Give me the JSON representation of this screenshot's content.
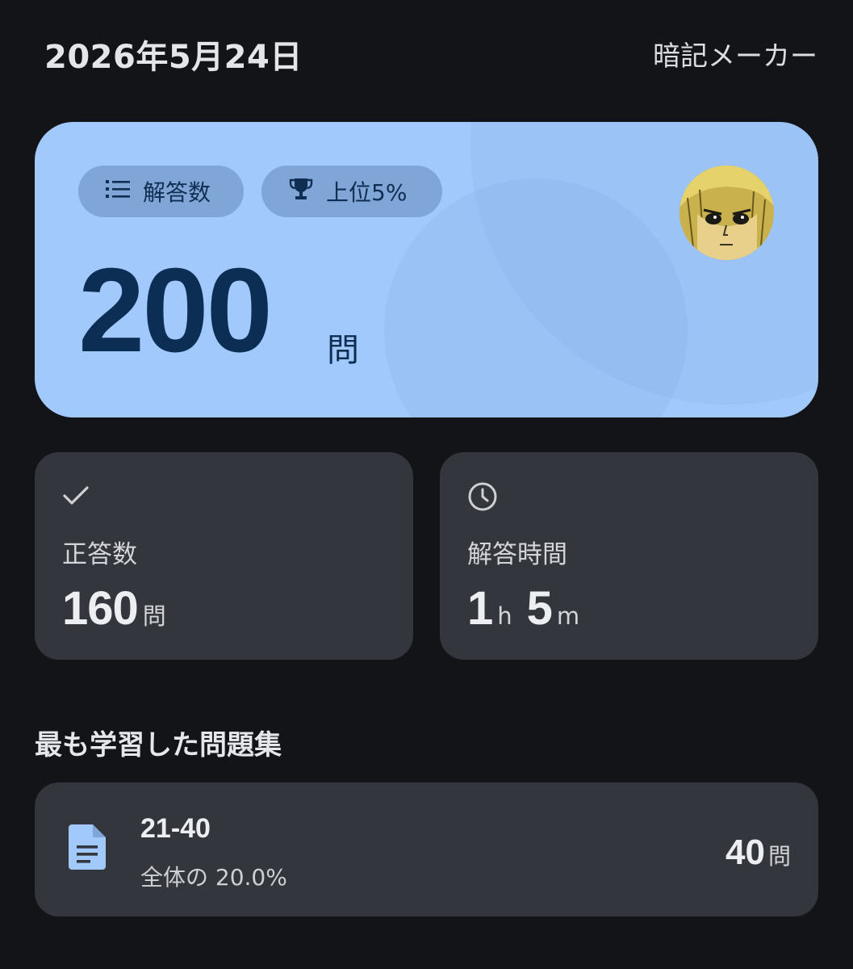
{
  "header": {
    "date": "2026年5月24日",
    "app_name": "暗記メーカー"
  },
  "summary": {
    "chip_answers_label": "解答数",
    "chip_rank_label": "上位5%",
    "total_count": "200",
    "total_unit": "問",
    "icons": [
      "list-icon",
      "trophy-icon",
      "avatar"
    ],
    "card_color": "#a1c9fb"
  },
  "stats": {
    "correct": {
      "icon": "check-icon",
      "label": "正答数",
      "value": "160",
      "unit": "問"
    },
    "time": {
      "icon": "clock-icon",
      "label": "解答時間",
      "hours": "1",
      "hours_unit": "h",
      "minutes": "5",
      "minutes_unit": "m"
    }
  },
  "most_studied": {
    "title": "最も学習した問題集",
    "book": {
      "icon": "document-icon",
      "name": "21-40",
      "share": "全体の 20.0%",
      "count": "40",
      "count_unit": "問"
    }
  }
}
